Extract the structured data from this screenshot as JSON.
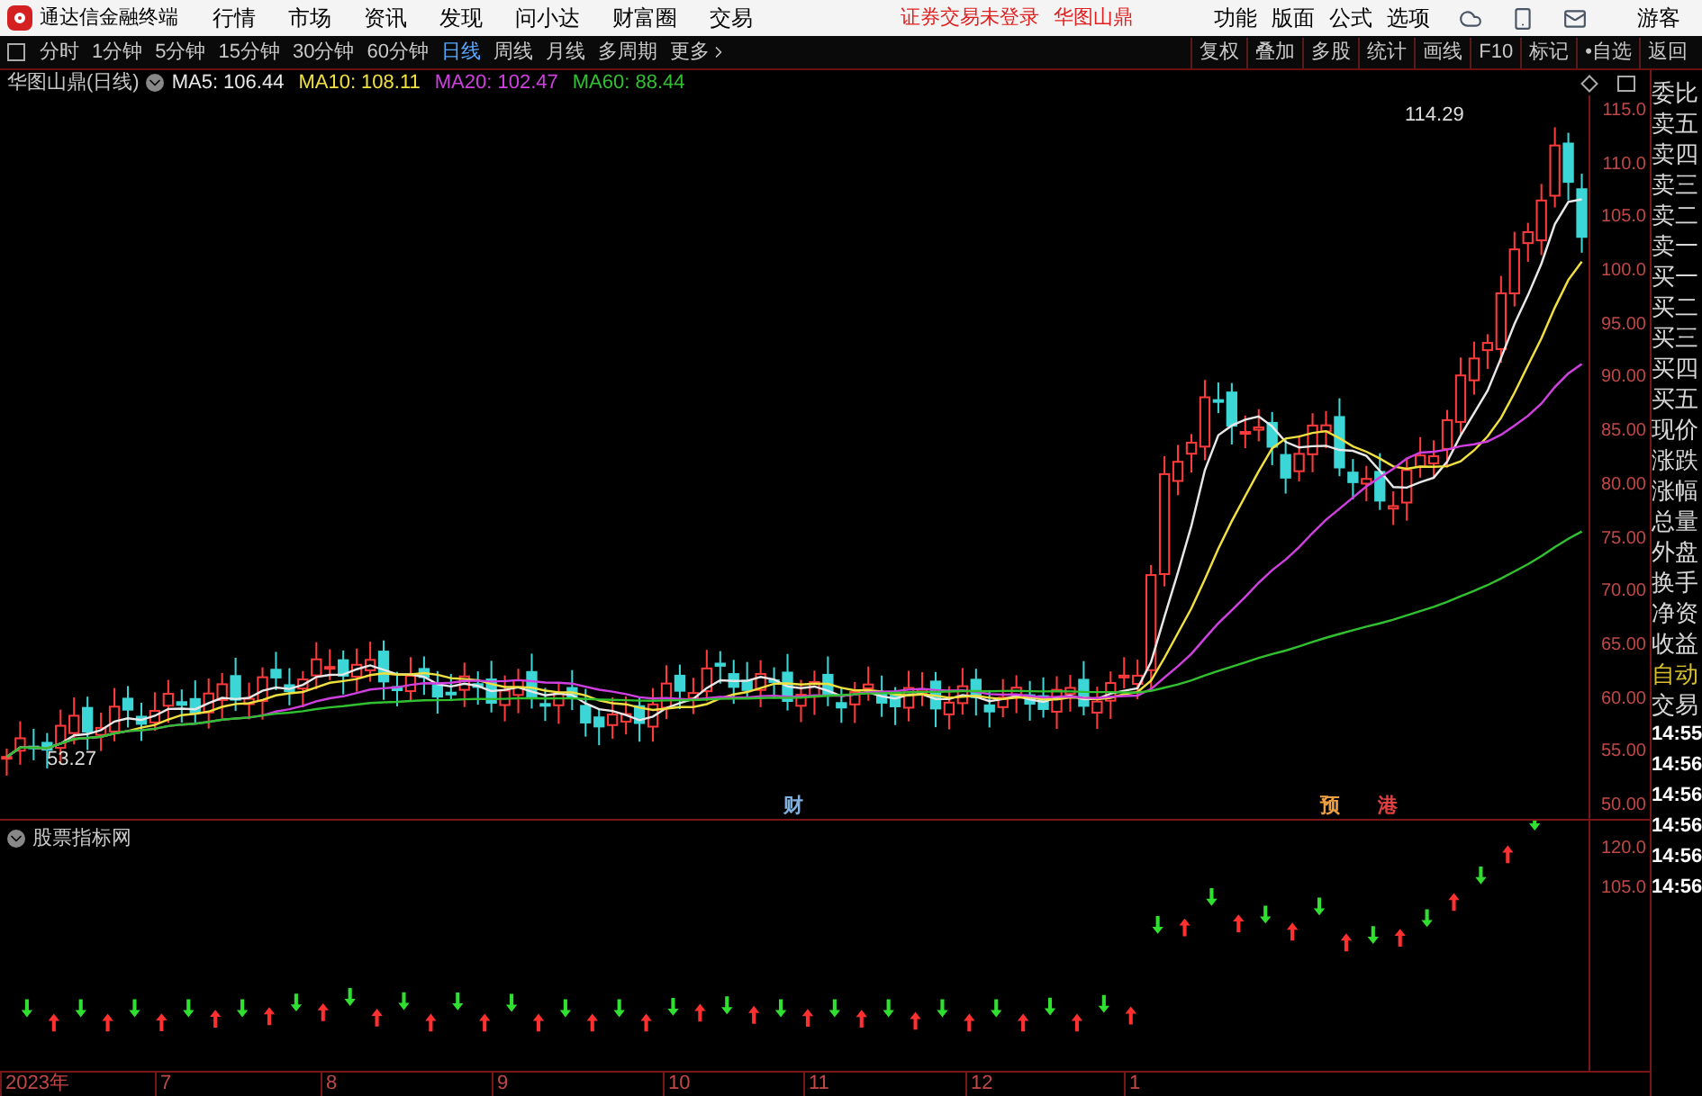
{
  "app": {
    "title": "通达信金融终端"
  },
  "menu": [
    "行情",
    "市场",
    "资讯",
    "发现",
    "问小达",
    "财富圈",
    "交易"
  ],
  "notice": "证券交易未登录",
  "stock_link": "华图山鼎",
  "right_menu": [
    "功能",
    "版面",
    "公式",
    "选项"
  ],
  "guest": "游客",
  "periods": [
    {
      "label": "分时",
      "selected": false
    },
    {
      "label": "1分钟",
      "selected": false
    },
    {
      "label": "5分钟",
      "selected": false
    },
    {
      "label": "15分钟",
      "selected": false
    },
    {
      "label": "30分钟",
      "selected": false
    },
    {
      "label": "60分钟",
      "selected": false
    },
    {
      "label": "日线",
      "selected": true
    },
    {
      "label": "周线",
      "selected": false
    },
    {
      "label": "月线",
      "selected": false
    },
    {
      "label": "多周期",
      "selected": false
    }
  ],
  "more": "更多",
  "tools": [
    "复权",
    "叠加",
    "多股",
    "统计",
    "画线",
    "F10",
    "标记",
    "•自选",
    "返回"
  ],
  "chart": {
    "title": "华图山鼎(日线)",
    "ma": [
      {
        "label": "MA5: 106.44",
        "color": "#e8e8e8"
      },
      {
        "label": "MA10: 108.11",
        "color": "#f0e040"
      },
      {
        "label": "MA20: 102.47",
        "color": "#d040e0"
      },
      {
        "label": "MA60: 88.44",
        "color": "#30c030"
      }
    ],
    "high_label": "114.29",
    "low_label": "53.27",
    "yticks": [
      "115.0",
      "110.0",
      "105.0",
      "100.0",
      "95.00",
      "90.00",
      "85.00",
      "80.00",
      "75.00",
      "70.00",
      "65.00",
      "60.00",
      "55.00",
      "50.00"
    ],
    "events": [
      {
        "text": "财",
        "color": "#7fb0e0"
      },
      {
        "text": "预",
        "color": "#f0a040"
      },
      {
        "text": "港",
        "color": "#e04040"
      }
    ]
  },
  "indicator": {
    "title": "股票指标网",
    "yticks": [
      "120.0",
      "105.0"
    ]
  },
  "date_axis": [
    "2023年",
    "7",
    "8",
    "9",
    "10",
    "11",
    "12",
    "1"
  ],
  "side_panel": [
    {
      "text": "委比",
      "kind": "label"
    },
    {
      "text": "卖五",
      "kind": "label"
    },
    {
      "text": "卖四",
      "kind": "label"
    },
    {
      "text": "卖三",
      "kind": "label"
    },
    {
      "text": "卖二",
      "kind": "label"
    },
    {
      "text": "卖一",
      "kind": "label"
    },
    {
      "text": "买一",
      "kind": "label"
    },
    {
      "text": "买二",
      "kind": "label"
    },
    {
      "text": "买三",
      "kind": "label"
    },
    {
      "text": "买四",
      "kind": "label"
    },
    {
      "text": "买五",
      "kind": "label"
    },
    {
      "text": "现价",
      "kind": "label"
    },
    {
      "text": "涨跌",
      "kind": "label"
    },
    {
      "text": "涨幅",
      "kind": "label"
    },
    {
      "text": "总量",
      "kind": "label"
    },
    {
      "text": "外盘",
      "kind": "label"
    },
    {
      "text": "换手",
      "kind": "label"
    },
    {
      "text": "净资",
      "kind": "label"
    },
    {
      "text": "收益",
      "kind": "label"
    },
    {
      "text": "自动",
      "kind": "highlight"
    },
    {
      "text": "交易",
      "kind": "label"
    },
    {
      "text": "14:55",
      "kind": "time"
    },
    {
      "text": "14:56",
      "kind": "time"
    },
    {
      "text": "14:56",
      "kind": "time"
    },
    {
      "text": "14:56",
      "kind": "time"
    },
    {
      "text": "14:56",
      "kind": "time"
    },
    {
      "text": "14:56",
      "kind": "time"
    }
  ]
}
